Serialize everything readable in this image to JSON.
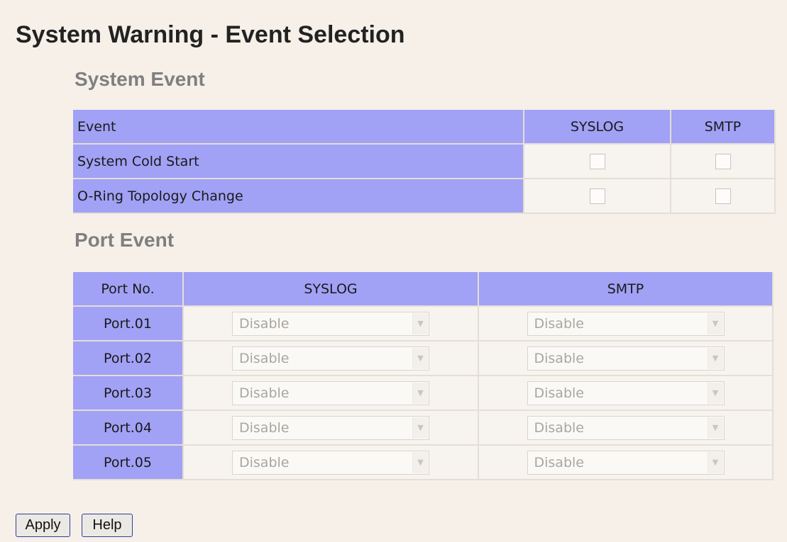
{
  "page": {
    "title": "System Warning - Event Selection"
  },
  "system_event": {
    "title": "System Event",
    "headers": {
      "event": "Event",
      "syslog": "SYSLOG",
      "smtp": "SMTP"
    },
    "rows": [
      {
        "event": "System Cold Start",
        "syslog_checked": false,
        "smtp_checked": false
      },
      {
        "event": "O-Ring Topology Change",
        "syslog_checked": false,
        "smtp_checked": false
      }
    ]
  },
  "port_event": {
    "title": "Port Event",
    "headers": {
      "port": "Port No.",
      "syslog": "SYSLOG",
      "smtp": "SMTP"
    },
    "rows": [
      {
        "port": "Port.01",
        "syslog": "Disable",
        "smtp": "Disable"
      },
      {
        "port": "Port.02",
        "syslog": "Disable",
        "smtp": "Disable"
      },
      {
        "port": "Port.03",
        "syslog": "Disable",
        "smtp": "Disable"
      },
      {
        "port": "Port.04",
        "syslog": "Disable",
        "smtp": "Disable"
      },
      {
        "port": "Port.05",
        "syslog": "Disable",
        "smtp": "Disable"
      }
    ]
  },
  "buttons": {
    "apply": "Apply",
    "help": "Help"
  },
  "colors": {
    "header_bg": "#a1a1f6",
    "page_bg": "#f6f0e9",
    "section_title": "#7f7f7f",
    "button_border": "#2c3f94"
  },
  "icons": {
    "select_arrow": "chevron-down-icon"
  }
}
